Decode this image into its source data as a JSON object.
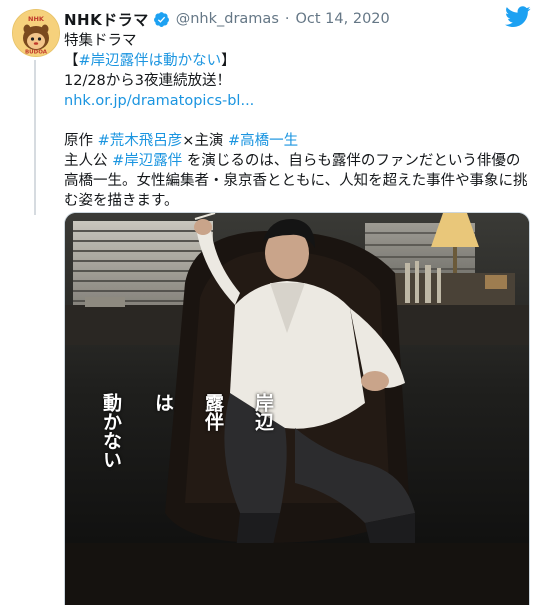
{
  "account": {
    "name": "NHKドラマ",
    "handle": "@nhk_dramas",
    "separator": "·",
    "date": "Oct 14, 2020",
    "avatar_icon": "nhk-mascot-avatar",
    "avatar_text": "NHK BUDOA"
  },
  "tweet": {
    "line1": "特集ドラマ",
    "line2_open": "【",
    "line2_tag": "#岸辺露伴は動かない",
    "line2_close": "】",
    "line3": "12/28から3夜連続放送！",
    "link": "nhk.or.jp/dramatopics-bl...",
    "credits_prefix": "原作 ",
    "credits_author_tag": "#荒木飛呂彦",
    "credits_mid": "×主演 ",
    "credits_actor_tag": "#高橋一生",
    "desc_prefix": "主人公 ",
    "desc_tag": "#岸辺露伴",
    "desc_rest": " を演じるのは、自らも露伴のファンだという俳優の高橋一生。女性編集者・泉京香とともに、人知を超えた事件や事象に挑む姿を描きます。"
  },
  "media": {
    "title_col1": "岸辺",
    "title_col2": "露伴",
    "title_col3": "は",
    "title_col4": "動かない"
  },
  "colors": {
    "link": "#1b95e0",
    "twitter_blue": "#1da1f2",
    "secondary_text": "#657786"
  }
}
